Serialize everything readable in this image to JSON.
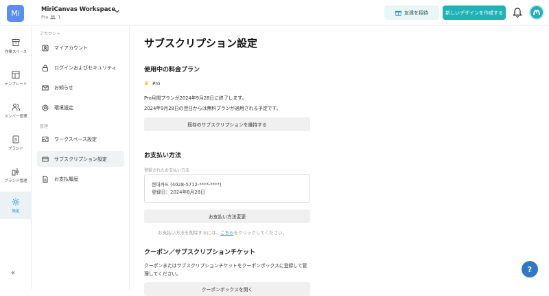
{
  "workspace": {
    "avatar_text": "Mi",
    "name": "MiriCanvas Workspace",
    "plan": "Pro",
    "members": "1"
  },
  "header": {
    "invite_label": "友達を招待",
    "create_label": "新しいデザインを作成する"
  },
  "rail": {
    "items": [
      {
        "label": "作業スペース",
        "icon": "archive-icon"
      },
      {
        "label": "テンプレート",
        "icon": "template-icon"
      },
      {
        "label": "メンバー管理",
        "icon": "members-icon"
      },
      {
        "label": "ブランド",
        "icon": "brand-icon"
      },
      {
        "label": "ブランド管理",
        "icon": "brand-manage-icon"
      },
      {
        "label": "設定",
        "icon": "gear-icon"
      }
    ]
  },
  "sidenav": {
    "section_account": "アカウント",
    "section_manage": "管理",
    "items": [
      {
        "label": "マイアカウント"
      },
      {
        "label": "ログインおよびセキュリティ"
      },
      {
        "label": "お知らせ"
      },
      {
        "label": "環境設定"
      },
      {
        "label": "ワークスペース設定"
      },
      {
        "label": "サブスクリプション設定"
      },
      {
        "label": "お支払履歴"
      }
    ]
  },
  "main": {
    "title": "サブスクリプション設定",
    "plan_section": "使用中の料金プラン",
    "plan_name": "Pro",
    "plan_line1": "Pro月間プランが2024年9月28日に終了します。",
    "plan_line2": "2024年9月28日の翌日からは無料プランが適用される予定です。",
    "keep_button": "既存のサブスクリプションを維持する",
    "payment_section": "お支払い方法",
    "payment_label": "登録されたお支払い方法",
    "card_line1": "현대카드 (4028-5712-****-****)",
    "card_line2": "登録日：2024年8月28日",
    "change_button": "お支払い方法変更",
    "delete_pre": "お支払い方法を削除するには、",
    "delete_link": "こちら",
    "delete_post": "をクリックしてください。",
    "coupon_section": "クーポン／サブスクリプションチケット",
    "coupon_line1": "クーポンまたはサブスクリプションチケットをクーポンボックスに登録して管",
    "coupon_line2": "理してください。",
    "coupon_button": "クーポンボックスを開く"
  },
  "help": {
    "icon": "help-icon"
  },
  "colors": {
    "accent": "#1fb2b7",
    "active_rail": "#1a8fb0"
  }
}
